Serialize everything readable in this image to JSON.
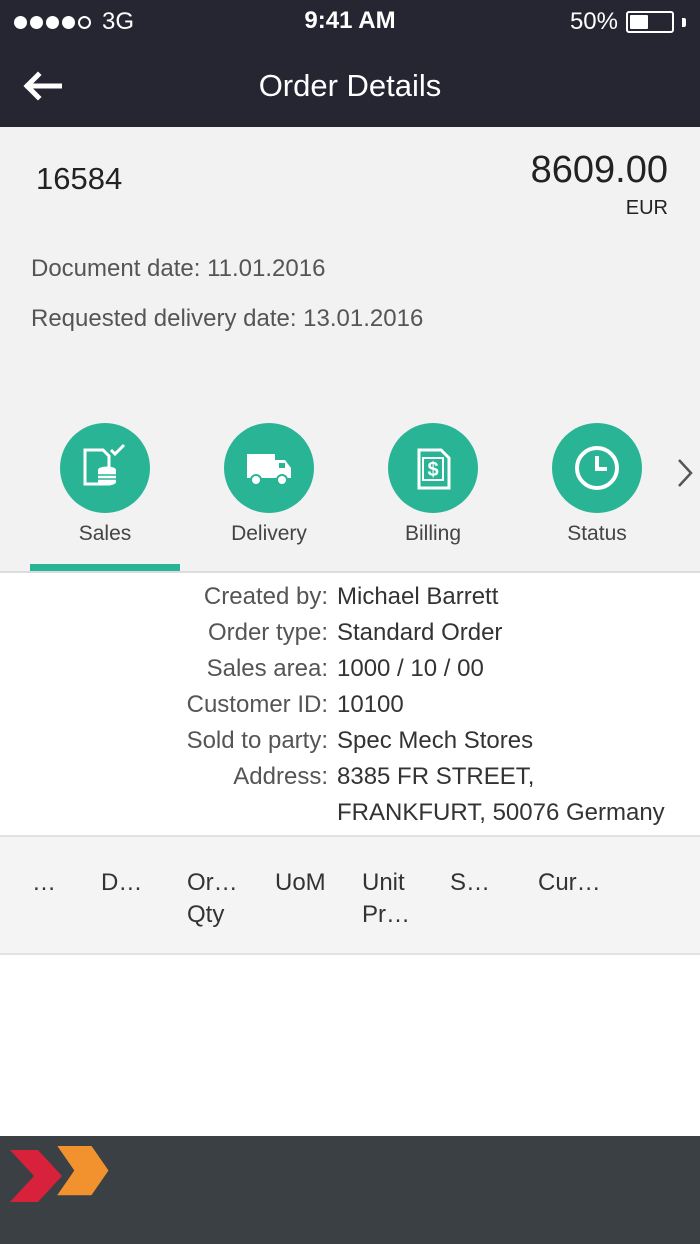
{
  "status_bar": {
    "carrier": "3G",
    "time": "9:41 AM",
    "battery": "50%",
    "battery_level": 0.5
  },
  "nav": {
    "title": "Order Details"
  },
  "order": {
    "number": "16584",
    "amount": "8609.00",
    "currency": "EUR",
    "document_date": "Document date: 11.01.2016",
    "requested_delivery_date": "Requested delivery date: 13.01.2016"
  },
  "tabs": [
    {
      "label": "Sales",
      "icon": "sales-docs-icon",
      "selected": true
    },
    {
      "label": "Delivery",
      "icon": "truck-icon"
    },
    {
      "label": "Billing",
      "icon": "invoice-dollar-icon"
    },
    {
      "label": "Status",
      "icon": "clock-icon"
    }
  ],
  "details": {
    "created_by": {
      "label": "Created by:",
      "value": "Michael Barrett"
    },
    "order_type": {
      "label": "Order type:",
      "value": "Standard Order"
    },
    "sales_area": {
      "label": "Sales area:",
      "value": "1000 / 10 / 00"
    },
    "customer_id": {
      "label": "Customer ID:",
      "value": "10100"
    },
    "sold_to": {
      "label": "Sold to party:",
      "value": "Spec Mech Stores"
    },
    "address": {
      "label": "Address:",
      "line1": "8385 FR STREET,",
      "line2": "FRANKFURT, 50076 Germany"
    }
  },
  "items_table": {
    "columns": [
      "…",
      "D…",
      "Or…\nQty",
      "UoM",
      "Unit\nPr…",
      "S…",
      "Cur…"
    ]
  },
  "colors": {
    "accent": "#2ab496",
    "top_bar": "#262632",
    "footer": "#3b4044",
    "logo_red": "#d8213a",
    "logo_orange": "#f2922e"
  }
}
